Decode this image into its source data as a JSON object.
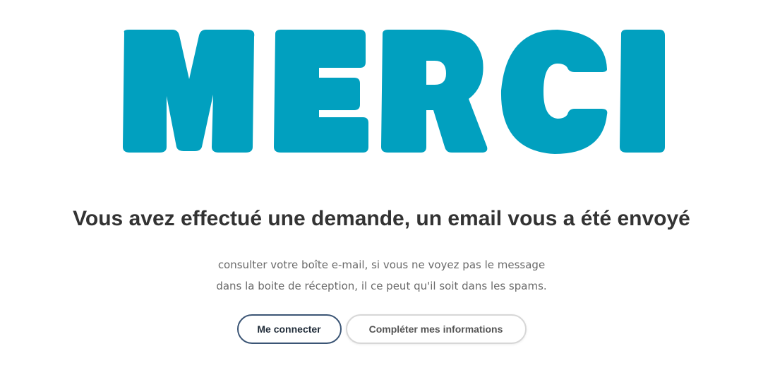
{
  "hero": {
    "word": "MERCI",
    "color": "#01a0bf"
  },
  "headline": "Vous avez effectué une demande, un email vous a été envoyé",
  "message": {
    "line1": "consulter votre boîte e-mail, si vous ne voyez pas le message",
    "line2": "dans la boite de réception, il ce peut qu'il soit dans les spams."
  },
  "actions": {
    "login_label": "Me connecter",
    "complete_label": "Compléter mes informations"
  }
}
